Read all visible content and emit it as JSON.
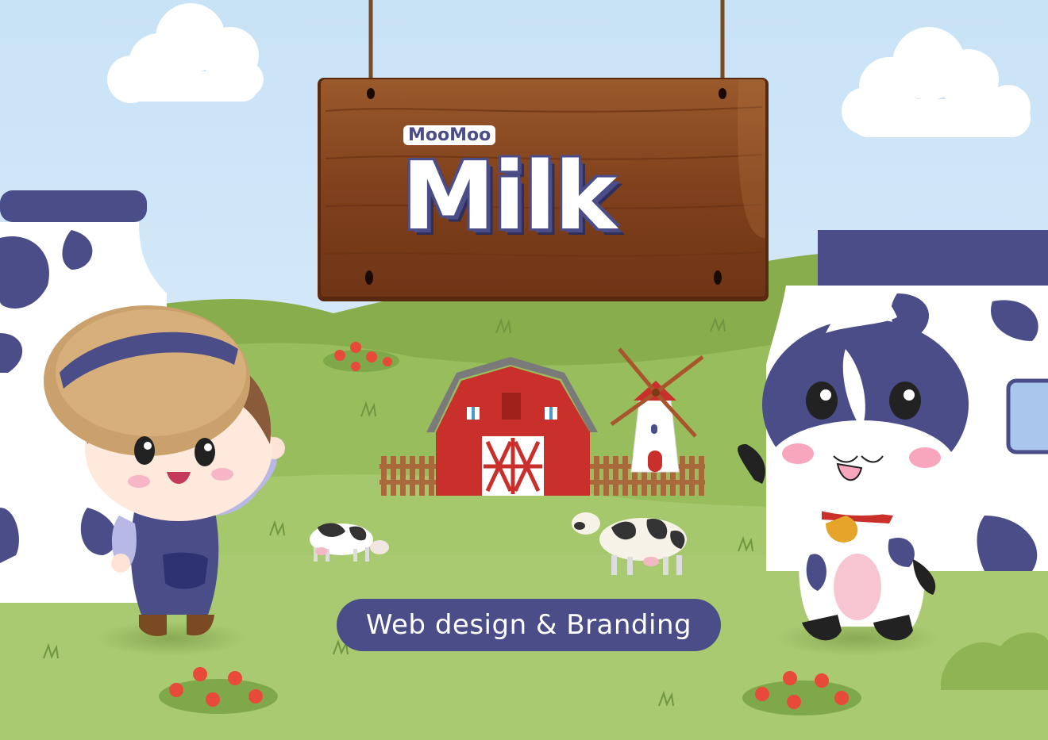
{
  "logo": {
    "top_text": "MooMoo",
    "main_text": "Milk"
  },
  "tagline": "Web design & Branding",
  "colors": {
    "sky": "#cfe6f7",
    "brand_navy": "#4a4d88",
    "grass_light": "#a3c76a",
    "grass_dark": "#7fa84a",
    "barn_red": "#c9302c",
    "wood": "#8b4a22"
  }
}
